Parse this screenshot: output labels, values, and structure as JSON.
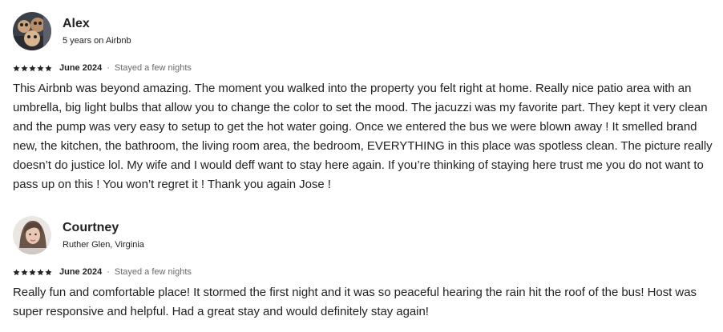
{
  "reviews": [
    {
      "name": "Alex",
      "subtitle": "5 years on Airbnb",
      "rating": 5,
      "date": "June 2024",
      "separator": "·",
      "stay": "Stayed a few nights",
      "text": "This Airbnb was beyond amazing. The moment you walked into the property you felt right at home. Really nice patio area with an umbrella, big light bulbs that allow you to change the color to set the mood. The jacuzzi was my favorite part. They kept it very clean and the pump was very easy to setup to get the hot water going. Once we entered the bus we were blown away ! It smelled brand new, the kitchen, the bathroom, the living room area, the bedroom, EVERYTHING in this place was spotless clean. The picture really doesn’t do justice lol. My wife and I would deff want to stay here again. If you’re thinking of staying here trust me you do not want to pass up on this ! You won’t regret it ! Thank you again Jose !"
    },
    {
      "name": "Courtney",
      "subtitle": "Ruther Glen, Virginia",
      "rating": 5,
      "date": "June 2024",
      "separator": "·",
      "stay": "Stayed a few nights",
      "text": "Really fun and comfortable place! It stormed the first night and it was so peaceful hearing the rain hit the roof of the bus! Host was super responsive and helpful. Had a great stay and would definitely stay again!"
    }
  ],
  "colors": {
    "text": "#222222",
    "muted": "#6a6a6a",
    "star": "#222222"
  },
  "icons": {
    "star": "star-icon",
    "avatar": "avatar"
  }
}
